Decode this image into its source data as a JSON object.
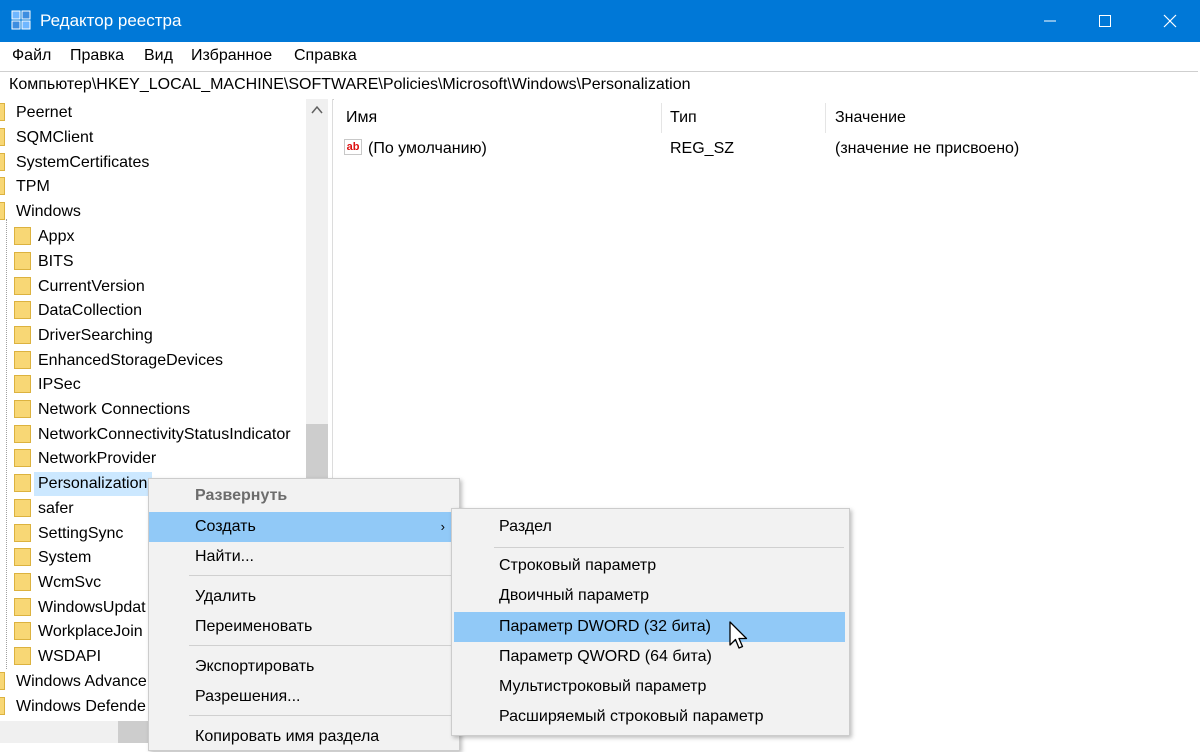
{
  "window": {
    "title": "Редактор реестра",
    "minimize_glyph": "—",
    "maximize_glyph": "☐",
    "close_glyph": "✕"
  },
  "menubar": [
    "Файл",
    "Правка",
    "Вид",
    "Избранное",
    "Справка"
  ],
  "address": "Компьютер\\HKEY_LOCAL_MACHINE\\SOFTWARE\\Policies\\Microsoft\\Windows\\Personalization",
  "tree": {
    "top_level": [
      "Peernet",
      "SQMClient",
      "SystemCertificates",
      "TPM",
      "Windows"
    ],
    "windows_children": [
      "Appx",
      "BITS",
      "CurrentVersion",
      "DataCollection",
      "DriverSearching",
      "EnhancedStorageDevices",
      "IPSec",
      "Network Connections",
      "NetworkConnectivityStatusIndicator",
      "NetworkProvider",
      "Personalization",
      "safer",
      "SettingSync",
      "System",
      "WcmSvc",
      "WindowsUpdat",
      "WorkplaceJoin",
      "WSDAPI"
    ],
    "after": [
      "Windows Advance",
      "Windows Defende"
    ],
    "selected": "Personalization"
  },
  "values": {
    "columns": [
      "Имя",
      "Тип",
      "Значение"
    ],
    "rows": [
      {
        "icon": "ab",
        "name": "(По умолчанию)",
        "type": "REG_SZ",
        "data": "(значение не присвоено)"
      }
    ]
  },
  "context_menu": {
    "items": [
      "Развернуть",
      "Создать",
      "Найти...",
      "Удалить",
      "Переименовать",
      "Экспортировать",
      "Разрешения...",
      "Копировать имя раздела"
    ],
    "highlighted": "Создать",
    "submenu_arrow": "›"
  },
  "submenu": {
    "items": [
      "Раздел",
      "Строковый параметр",
      "Двоичный параметр",
      "Параметр DWORD (32 бита)",
      "Параметр QWORD (64 бита)",
      "Мультистроковый параметр",
      "Расширяемый строковый параметр"
    ],
    "highlighted": "Параметр DWORD (32 бита)"
  },
  "colors": {
    "titlebar": "#0078d7",
    "selection": "#cce8ff",
    "menu_hover": "#91c9f7",
    "menu_bg": "#f2f2f2",
    "folder": "#f8d775"
  }
}
